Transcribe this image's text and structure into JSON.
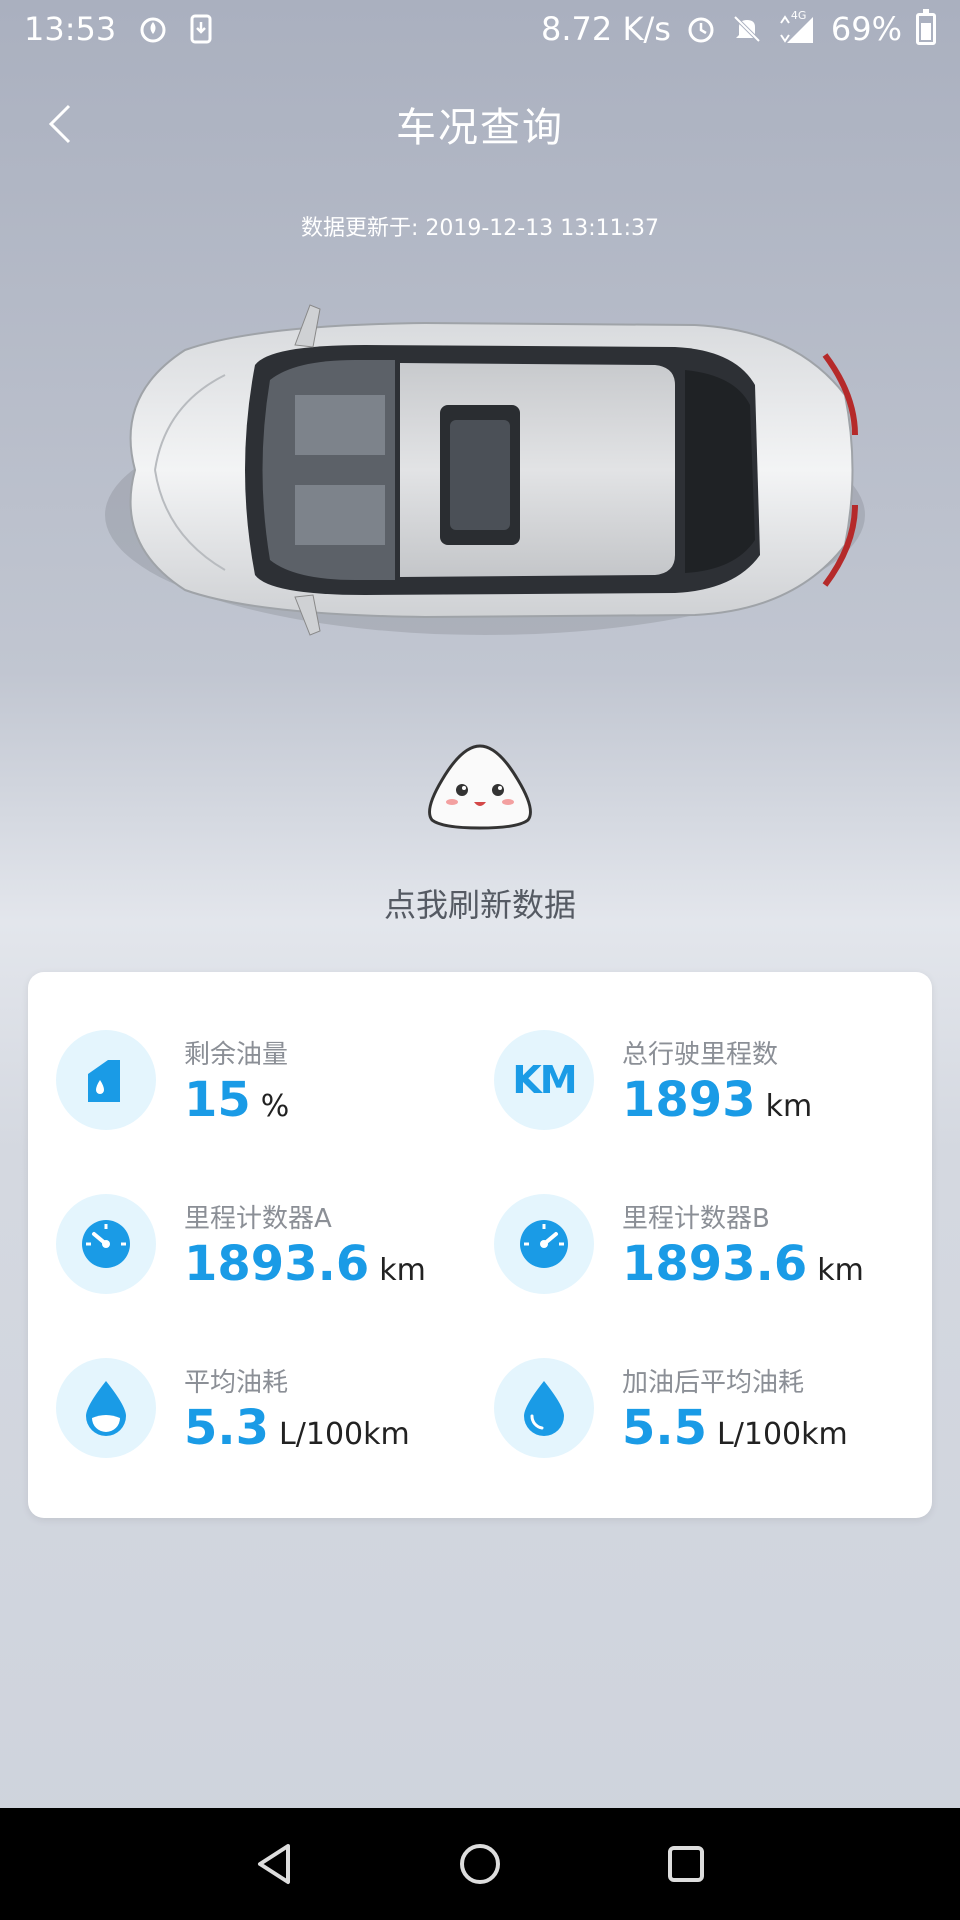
{
  "status_bar": {
    "time": "13:53",
    "network_speed": "8.72 K/s",
    "network_type": "4G",
    "battery": "69%",
    "icons": [
      "fire-icon",
      "download-icon",
      "alarm-icon",
      "mute-icon",
      "signal-icon",
      "battery-icon"
    ]
  },
  "header": {
    "title": "车况查询",
    "back_icon": "chevron-left-icon"
  },
  "update": {
    "label": "数据更新于:",
    "timestamp": "2019-12-13 13:11:37"
  },
  "refresh": {
    "label": "点我刷新数据"
  },
  "metrics": [
    {
      "label": "剩余油量",
      "value": "15",
      "unit": "%",
      "icon": "fuel-can-icon"
    },
    {
      "label": "总行驶里程数",
      "value": "1893",
      "unit": "km",
      "icon": "km-icon"
    },
    {
      "label": "里程计数器A",
      "value": "1893.6",
      "unit": "km",
      "icon": "gauge-a-icon"
    },
    {
      "label": "里程计数器B",
      "value": "1893.6",
      "unit": "km",
      "icon": "gauge-b-icon"
    },
    {
      "label": "平均油耗",
      "value": "5.3",
      "unit": "L/100km",
      "icon": "half-drop-icon"
    },
    {
      "label": "加油后平均油耗",
      "value": "5.5",
      "unit": "L/100km",
      "icon": "full-drop-icon"
    }
  ],
  "km_icon_text": "KM",
  "colors": {
    "accent": "#1a9be6",
    "icon_bg": "#e4f5fd"
  }
}
